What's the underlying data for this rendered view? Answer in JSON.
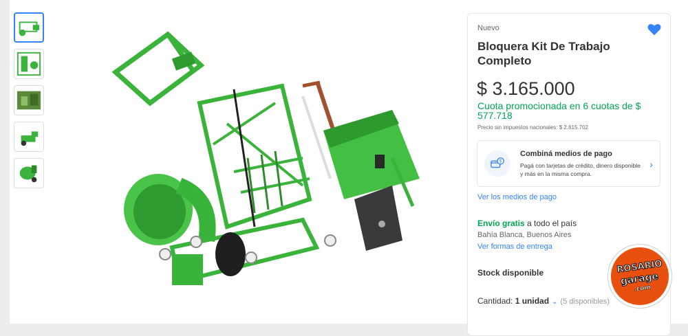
{
  "gallery": {
    "thumbnails": [
      {
        "name": "thumb-1",
        "active": true
      },
      {
        "name": "thumb-2",
        "active": false
      },
      {
        "name": "thumb-3",
        "active": false
      },
      {
        "name": "thumb-4",
        "active": false
      },
      {
        "name": "thumb-5",
        "active": false
      }
    ],
    "main_image_icon": "product-image"
  },
  "product": {
    "condition": "Nuevo",
    "title": "Bloquera Kit De Trabajo Completo",
    "price": "$ 3.165.000",
    "installments": "Cuota promocionada en 6 cuotas de $ 577.718",
    "taxes": "Precio sin impuestos nacionales: $ 2.615.702",
    "favorite_icon": "heart-icon"
  },
  "payment": {
    "title": "Combiná medios de pago",
    "description": "Pagá con tarjetas de crédito, dinero disponible y más en la misma compra.",
    "link": "Ver los medios de pago",
    "icon": "payment-icon"
  },
  "shipping": {
    "free_label": "Envío gratis",
    "rest": " a todo el país",
    "location": "Bahía Blanca, Buenos Aires",
    "link": "Ver formas de entrega"
  },
  "stock": {
    "label": "Stock disponible",
    "quantity_label": "Cantidad: ",
    "quantity_value": "1 unidad",
    "available": "(5 disponibles)"
  },
  "watermark": {
    "line1": "ROSARIO",
    "line2": "garage",
    "line3": ".com"
  },
  "colors": {
    "accent": "#3483fa",
    "green": "#00a650",
    "badge": "#e8500f"
  }
}
